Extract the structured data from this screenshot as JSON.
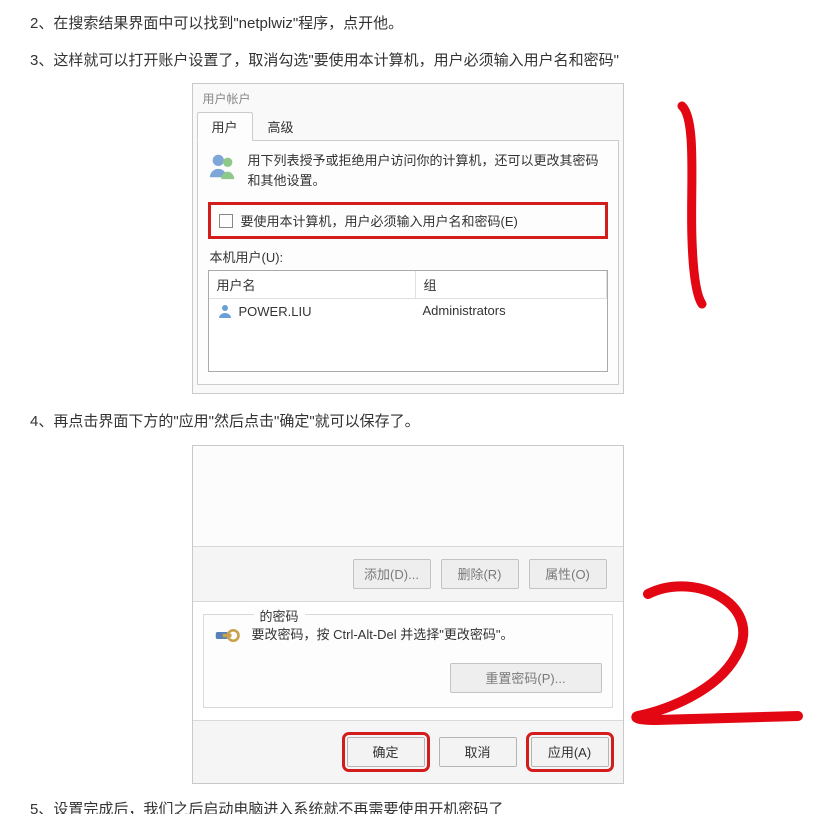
{
  "steps": {
    "s2": "2、在搜索结果界面中可以找到\"netplwiz\"程序，点开他。",
    "s3": "3、这样就可以打开账户设置了，取消勾选\"要使用本计算机，用户必须输入用户名和密码\"",
    "s4": "4、再点击界面下方的\"应用\"然后点击\"确定\"就可以保存了。",
    "s5": "5、设置完成后，我们之后启动电脑进入系统就不再需要使用开机密码了"
  },
  "dialog1": {
    "title": "用户帐户",
    "tabs": {
      "users": "用户",
      "advanced": "高级"
    },
    "desc": "用下列表授予或拒绝用户访问你的计算机，还可以更改其密码和其他设置。",
    "checkbox": "要使用本计算机，用户必须输入用户名和密码(E)",
    "listLabel": "本机用户(U):",
    "col_user": "用户名",
    "col_group": "组",
    "row_user": "POWER.LIU",
    "row_group": "Administrators"
  },
  "dialog2": {
    "add": "添加(D)...",
    "remove": "删除(R)",
    "props": "属性(O)",
    "pwdLegend": "的密码",
    "pwdText": "要改密码，按 Ctrl-Alt-Del 并选择\"更改密码\"。",
    "reset": "重置密码(P)...",
    "ok": "确定",
    "cancel": "取消",
    "apply": "应用(A)"
  }
}
